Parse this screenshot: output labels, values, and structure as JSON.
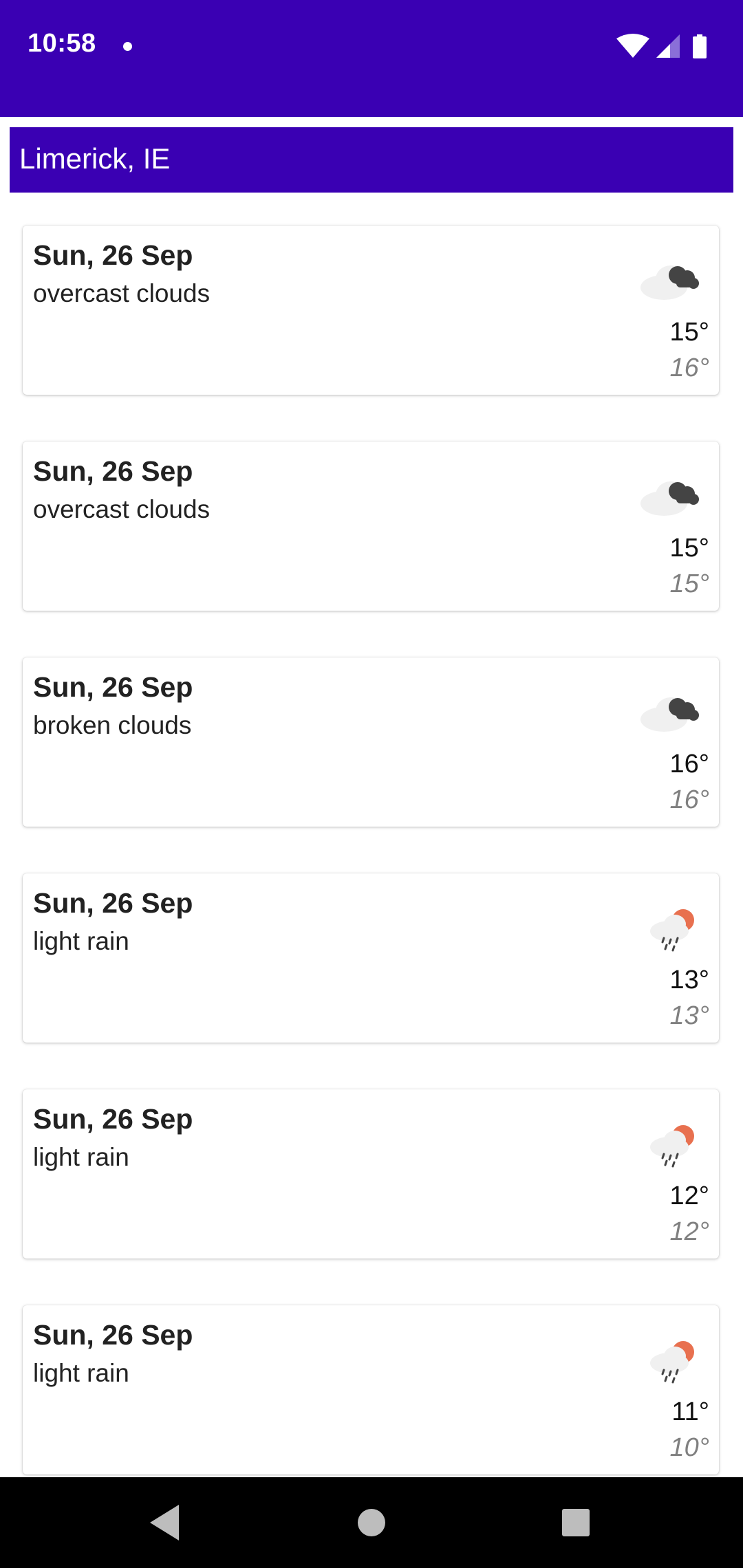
{
  "status_bar": {
    "time": "10:58",
    "background_color": "#3a00b3",
    "icons": [
      "notification-dot-icon",
      "wifi-icon",
      "signal-icon",
      "battery-icon"
    ]
  },
  "location": {
    "label": "Limerick, IE",
    "background_color": "#3a00b3"
  },
  "forecast": [
    {
      "date": "Sun, 26 Sep",
      "description": "overcast clouds",
      "temp": "15°",
      "feels": "16°",
      "icon": "overcast-clouds-icon"
    },
    {
      "date": "Sun, 26 Sep",
      "description": "overcast clouds",
      "temp": "15°",
      "feels": "15°",
      "icon": "overcast-clouds-icon"
    },
    {
      "date": "Sun, 26 Sep",
      "description": "broken clouds",
      "temp": "16°",
      "feels": "16°",
      "icon": "broken-clouds-icon"
    },
    {
      "date": "Sun, 26 Sep",
      "description": "light rain",
      "temp": "13°",
      "feels": "13°",
      "icon": "light-rain-icon"
    },
    {
      "date": "Sun, 26 Sep",
      "description": "light rain",
      "temp": "12°",
      "feels": "12°",
      "icon": "light-rain-icon"
    },
    {
      "date": "Sun, 26 Sep",
      "description": "light rain",
      "temp": "11°",
      "feels": "10°",
      "icon": "light-rain-icon"
    }
  ],
  "navigation": {
    "buttons": [
      "back-icon",
      "home-icon",
      "recents-icon"
    ]
  }
}
